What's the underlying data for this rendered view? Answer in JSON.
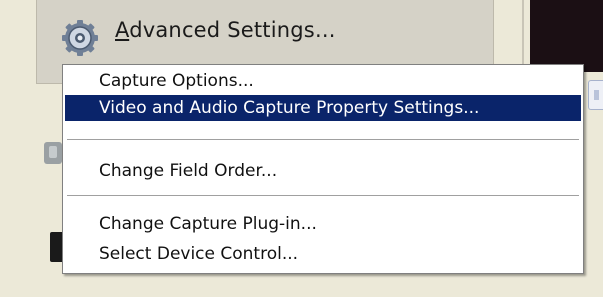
{
  "advanced_settings": {
    "label_prefix": "",
    "label_mnemonic": "A",
    "label_rest": "dvanced Settings...",
    "icon": "gear-icon"
  },
  "context_menu": {
    "items": [
      {
        "label": "Capture Options...",
        "selected": false
      },
      {
        "label": "Video and Audio Capture Property Settings...",
        "selected": true
      },
      {
        "label": "Change Field Order...",
        "selected": false
      },
      {
        "label": "Change Capture Plug-in...",
        "selected": false
      },
      {
        "label": "Select Device Control...",
        "selected": false
      }
    ]
  },
  "colors": {
    "highlight": "#0a246a",
    "panel": "#ece9d8",
    "preview": "#1b0f14"
  }
}
